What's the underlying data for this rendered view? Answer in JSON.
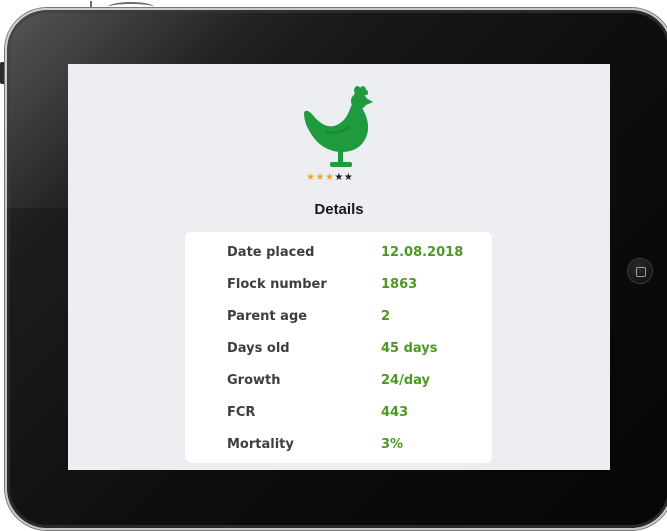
{
  "app": {
    "title": "Details",
    "rating": {
      "filled": 3,
      "total": 5
    },
    "colors": {
      "accent": "#4a9a22",
      "logo": "#1f9a3c",
      "star": "#f0a62a"
    }
  },
  "icons": {
    "logo": "chicken-icon",
    "device_home": "home-button-icon"
  },
  "details": [
    {
      "label": "Date placed",
      "value": "12.08.2018"
    },
    {
      "label": "Flock number",
      "value": "1863"
    },
    {
      "label": "Parent age",
      "value": "2"
    },
    {
      "label": "Days old",
      "value": "45 days"
    },
    {
      "label": "Growth",
      "value": "24/day"
    },
    {
      "label": "FCR",
      "value": "443"
    },
    {
      "label": "Mortality",
      "value": "3%"
    }
  ]
}
